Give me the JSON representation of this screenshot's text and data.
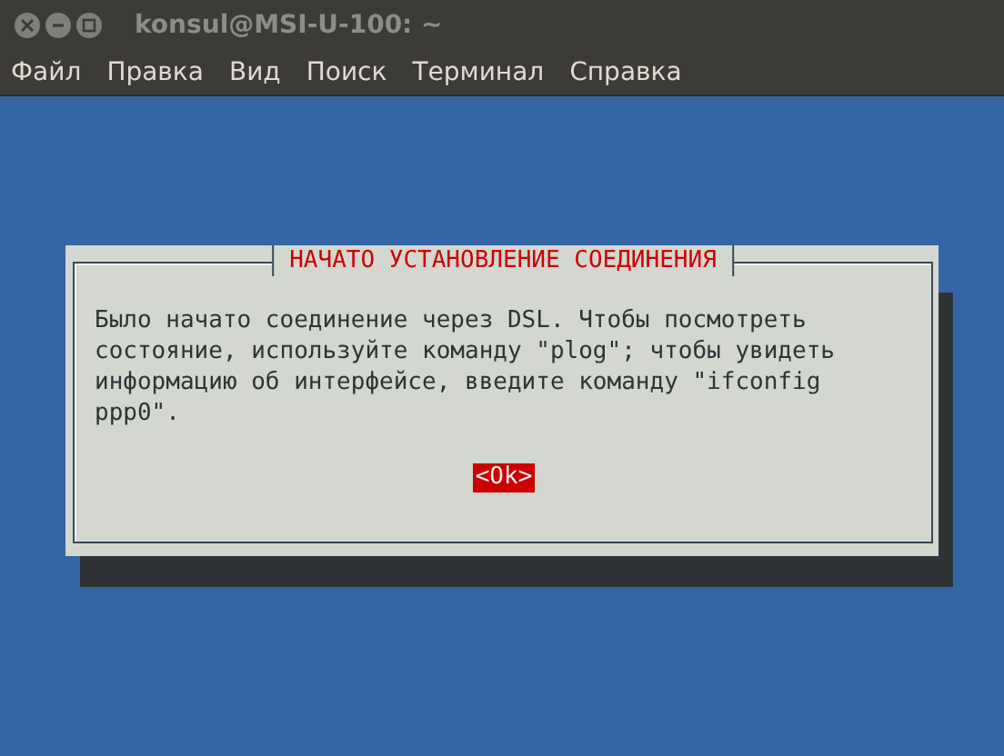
{
  "window": {
    "title": "konsul@MSI-U-100: ~"
  },
  "menu": [
    "Файл",
    "Правка",
    "Вид",
    "Поиск",
    "Терминал",
    "Справка"
  ],
  "dialog": {
    "title": "НАЧАТО УСТАНОВЛЕНИЕ СОЕДИНЕНИЯ",
    "message": "Было начато соединение через DSL. Чтобы посмотреть\nсостояние, используйте команду \"plog\"; чтобы увидеть\nинформацию об интерфейсе, введите команду \"ifconfig\nppp0\".",
    "buttons": [
      {
        "label": "<Ok>",
        "selected": true
      }
    ]
  }
}
